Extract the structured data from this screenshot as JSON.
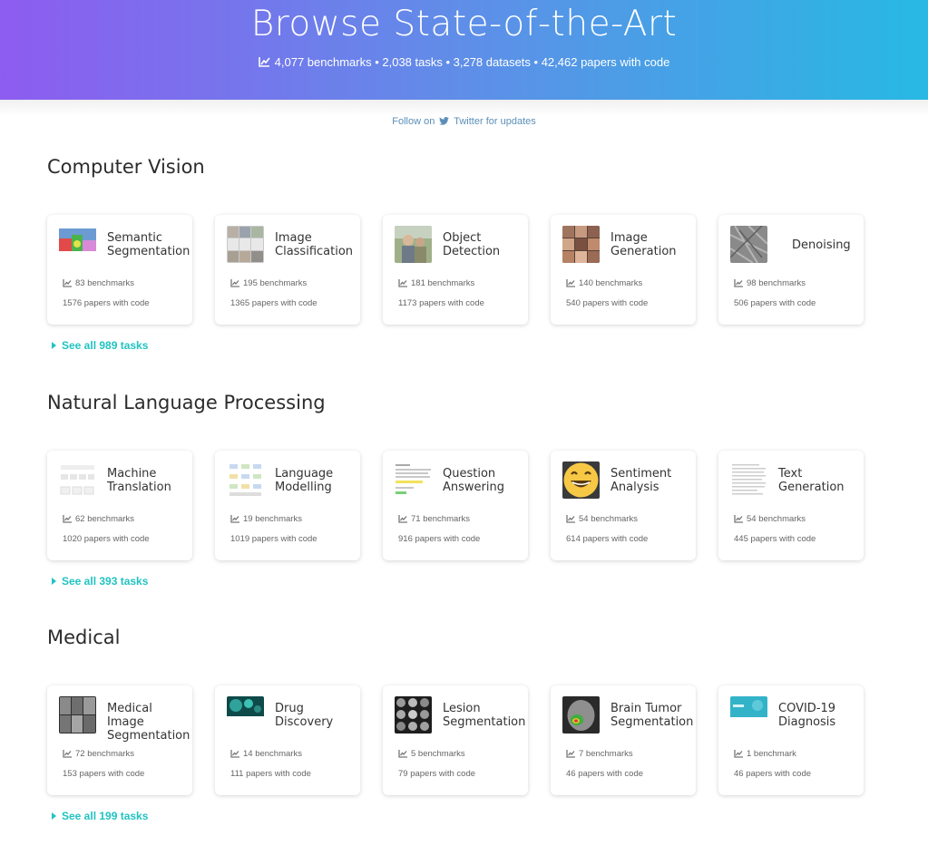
{
  "hero": {
    "title": "Browse State-of-the-Art",
    "stats": "4,077 benchmarks • 2,038 tasks • 3,278 datasets • 42,462 papers with code"
  },
  "follow": {
    "prefix": "Follow on",
    "link": "Twitter for updates"
  },
  "sections": [
    {
      "title": "Computer Vision",
      "see_all": "See all 989 tasks",
      "cards": [
        {
          "name": "Semantic Segmentation",
          "benchmarks": "83 benchmarks",
          "papers": "1576 papers with code",
          "thumb": "segmentation-thumbnail"
        },
        {
          "name": "Image Classification",
          "benchmarks": "195 benchmarks",
          "papers": "1365 papers with code",
          "thumb": "classification-thumbnail"
        },
        {
          "name": "Object Detection",
          "benchmarks": "181 benchmarks",
          "papers": "1173 papers with code",
          "thumb": "detection-thumbnail"
        },
        {
          "name": "Image Generation",
          "benchmarks": "140 benchmarks",
          "papers": "540 papers with code",
          "thumb": "faces-grid-thumbnail"
        },
        {
          "name": "Denoising",
          "benchmarks": "98 benchmarks",
          "papers": "506 papers with code",
          "thumb": "noisy-image-thumbnail"
        }
      ]
    },
    {
      "title": "Natural Language Processing",
      "see_all": "See all 393 tasks",
      "cards": [
        {
          "name": "Machine Translation",
          "benchmarks": "62 benchmarks",
          "papers": "1020 papers with code",
          "thumb": "translation-diagram-thumbnail"
        },
        {
          "name": "Language Modelling",
          "benchmarks": "19 benchmarks",
          "papers": "1019 papers with code",
          "thumb": "model-diagram-thumbnail"
        },
        {
          "name": "Question Answering",
          "benchmarks": "71 benchmarks",
          "papers": "916 papers with code",
          "thumb": "qa-text-thumbnail"
        },
        {
          "name": "Sentiment Analysis",
          "benchmarks": "54 benchmarks",
          "papers": "614 papers with code",
          "thumb": "smiley-emoji-thumbnail"
        },
        {
          "name": "Text Generation",
          "benchmarks": "54 benchmarks",
          "papers": "445 papers with code",
          "thumb": "text-page-thumbnail"
        }
      ]
    },
    {
      "title": "Medical",
      "see_all": "See all 199 tasks",
      "cards": [
        {
          "name": "Medical Image Segmentation",
          "benchmarks": "72 benchmarks",
          "papers": "153 papers with code",
          "thumb": "xray-grid-thumbnail"
        },
        {
          "name": "Drug Discovery",
          "benchmarks": "14 benchmarks",
          "papers": "111 papers with code",
          "thumb": "molecule-thumbnail"
        },
        {
          "name": "Lesion Segmentation",
          "benchmarks": "5 benchmarks",
          "papers": "79 papers with code",
          "thumb": "lesion-scan-thumbnail"
        },
        {
          "name": "Brain Tumor Segmentation",
          "benchmarks": "7 benchmarks",
          "papers": "46 papers with code",
          "thumb": "brain-mri-thumbnail"
        },
        {
          "name": "COVID-19 Diagnosis",
          "benchmarks": "1 benchmark",
          "papers": "46 papers with code",
          "thumb": "covid-banner-thumbnail"
        }
      ]
    }
  ],
  "colors": {
    "gradient_start": "#8d5cf0",
    "gradient_end": "#27b9e3",
    "see_all": "#21c3c2",
    "link": "#5b8fb9"
  }
}
